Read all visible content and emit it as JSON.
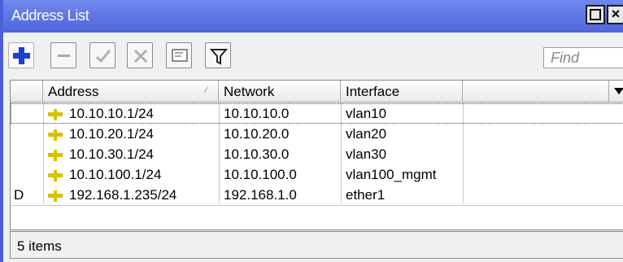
{
  "window": {
    "title": "Address List"
  },
  "toolbar": {
    "add_icon": "plus-icon",
    "remove_icon": "minus-icon",
    "enable_icon": "check-icon",
    "disable_icon": "x-icon",
    "comment_icon": "comment-icon",
    "filter_icon": "filter-icon",
    "find_placeholder": "Find"
  },
  "table": {
    "columns": [
      {
        "label": ""
      },
      {
        "label": "Address"
      },
      {
        "label": "Network"
      },
      {
        "label": "Interface"
      }
    ],
    "rows": [
      {
        "flag": "",
        "address": "10.10.10.1/24",
        "network": "10.10.10.0",
        "interface": "vlan10"
      },
      {
        "flag": "",
        "address": "10.10.20.1/24",
        "network": "10.10.20.0",
        "interface": "vlan20"
      },
      {
        "flag": "",
        "address": "10.10.30.1/24",
        "network": "10.10.30.0",
        "interface": "vlan30"
      },
      {
        "flag": "",
        "address": "10.10.100.1/24",
        "network": "10.10.100.0",
        "interface": "vlan100_mgmt"
      },
      {
        "flag": "D",
        "address": "192.168.1.235/24",
        "network": "192.168.1.0",
        "interface": "ether1"
      }
    ],
    "address_icon": "address-icon"
  },
  "status": {
    "count_text": "5 items"
  },
  "colors": {
    "titlebar": "#4f65dc",
    "add_icon": "#1a3fd0",
    "address_icon": "#d6c200"
  }
}
